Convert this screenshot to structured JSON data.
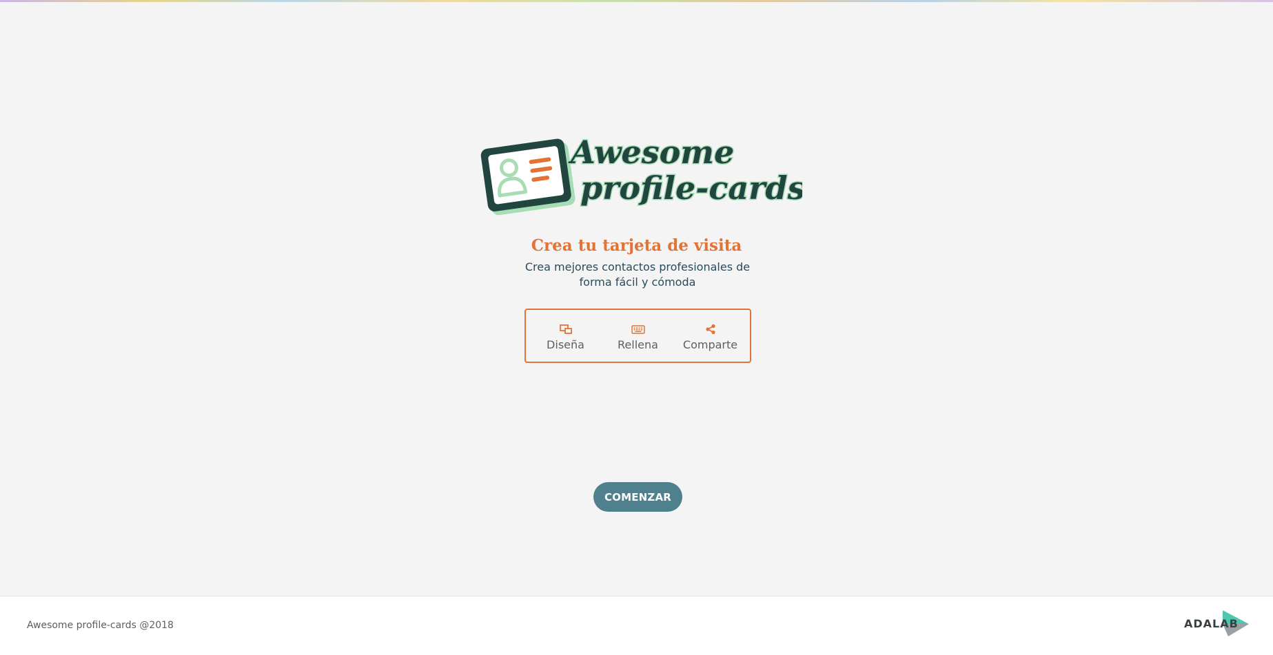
{
  "logo": {
    "title_line1": "Awesome",
    "title_line2": "profile-cards",
    "icon": "profile-card-icon",
    "colors": {
      "dark": "#21463f",
      "light_green": "#a8dcb4",
      "orange": "#e17334"
    }
  },
  "intro": {
    "heading": "Crea tu tarjeta de visita",
    "subheading": "Crea mejores contactos profesionales de forma fácil y cómoda"
  },
  "steps": [
    {
      "label": "Diseña",
      "icon": "design-icon"
    },
    {
      "label": "Rellena",
      "icon": "keyboard-icon"
    },
    {
      "label": "Comparte",
      "icon": "share-icon"
    }
  ],
  "start_button": {
    "label": "COMENZAR"
  },
  "footer": {
    "copyright": "Awesome profile-cards @2018",
    "brand_logo": {
      "text": "ADALAB",
      "icon": "adalab-logo"
    }
  },
  "colors": {
    "background": "#f4f4f4",
    "accent": "#e17334",
    "button": "#4f808e",
    "text": "#2b4a5a"
  }
}
